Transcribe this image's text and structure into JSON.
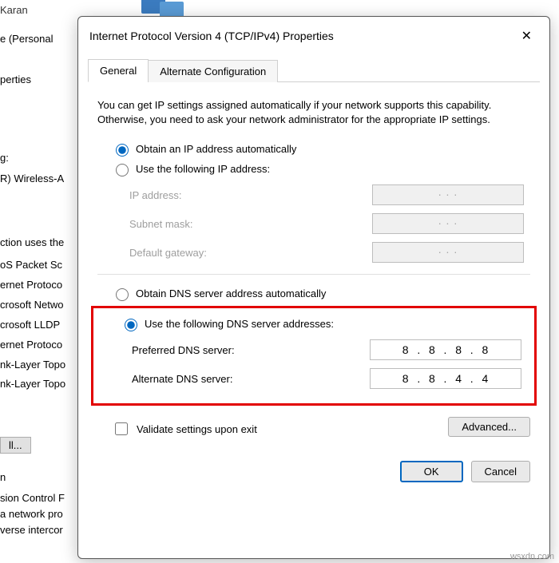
{
  "background": {
    "parent_title_fragment": "e (Personal",
    "properties_tab": "perties",
    "connect_using": "g:",
    "adapter_fragment": "R) Wireless-A",
    "uses_label": "ction uses the",
    "items": [
      "oS Packet Sc",
      "ernet Protoco",
      "crosoft Netwo",
      "crosoft LLDP",
      "ernet Protoco",
      "nk-Layer Topo",
      "nk-Layer Topo"
    ],
    "install_btn": "ll...",
    "desc_header": "n",
    "desc1": "sion Control F",
    "desc2": "a network pro",
    "desc3": "verse intercor",
    "user": "Karan"
  },
  "dialog": {
    "title": "Internet Protocol Version 4 (TCP/IPv4) Properties",
    "tabs": {
      "general": "General",
      "alternate": "Alternate Configuration"
    },
    "intro": "You can get IP settings assigned automatically if your network supports this capability. Otherwise, you need to ask your network administrator for the appropriate IP settings.",
    "ip": {
      "auto": "Obtain an IP address automatically",
      "manual": "Use the following IP address:",
      "address": "IP address:",
      "subnet": "Subnet mask:",
      "gateway": "Default gateway:",
      "placeholder": ".       .       ."
    },
    "dns": {
      "auto": "Obtain DNS server address automatically",
      "manual": "Use the following DNS server addresses:",
      "preferred": "Preferred DNS server:",
      "alternate": "Alternate DNS server:",
      "preferred_value": "8  .  8  .  8  .  8",
      "alternate_value": "8  .  8  .  4  .  4"
    },
    "validate": "Validate settings upon exit",
    "advanced": "Advanced...",
    "ok": "OK",
    "cancel": "Cancel"
  },
  "watermark": "wsxdn.com"
}
